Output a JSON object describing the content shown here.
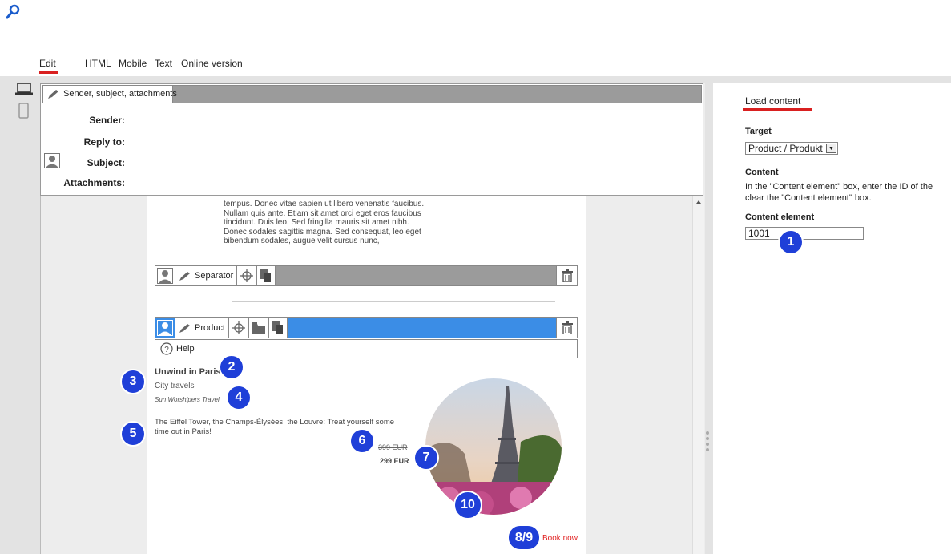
{
  "app": {
    "tabs": [
      "Edit",
      "HTML",
      "Mobile",
      "Text",
      "Online version"
    ],
    "active_tab": "Edit"
  },
  "header": {
    "toolbar_label": "Sender, subject, attachments",
    "fields": {
      "sender": "Sender:",
      "reply_to": "Reply to:",
      "subject": "Subject:",
      "attachments": "Attachments:"
    }
  },
  "email": {
    "lorem_lines": [
      "tempus. Donec vitae sapien ut libero venenatis faucibus.",
      "Nullam quis ante. Etiam sit amet orci eget eros faucibus",
      "tincidunt. Duis leo. Sed fringilla mauris sit amet nibh.",
      "Donec sodales sagittis magna. Sed consequat, leo eget",
      "bibendum sodales, augue velit cursus nunc,"
    ],
    "separator_label": "Separator",
    "product_label": "Product",
    "help_label": "Help",
    "product": {
      "title": "Unwind in Paris",
      "subtitle": "City travels",
      "vendor": "Sun Worshipers Travel",
      "description": "The Eiffel Tower, the Champs-Élysées, the Louvre: Treat yourself some time out in Paris!",
      "old_price": "399 EUR",
      "price": "299 EUR",
      "book_now": "Book now"
    }
  },
  "right_panel": {
    "title": "Load content",
    "target_label": "Target",
    "target_value": "Product / Produkt",
    "content_label": "Content",
    "content_text_1": "In the \"Content element\" box, enter the ID of the",
    "content_text_2": "clear the \"Content element\" box.",
    "content_element_label": "Content element",
    "content_element_value": "1001"
  },
  "badges": [
    "1",
    "2",
    "3",
    "4",
    "5",
    "6",
    "7",
    "8/9",
    "10"
  ],
  "colors": {
    "accent_red": "#d92020",
    "badge_blue": "#1f3fd8",
    "active_bar_blue": "#3b8de6",
    "toolbar_gray": "#9b9b9b"
  },
  "icons": [
    "search-icon",
    "laptop-icon",
    "mobile-icon",
    "pencil-icon",
    "user-icon",
    "crosshair-icon",
    "folder-icon",
    "copy-icon",
    "trash-icon",
    "help-icon"
  ]
}
